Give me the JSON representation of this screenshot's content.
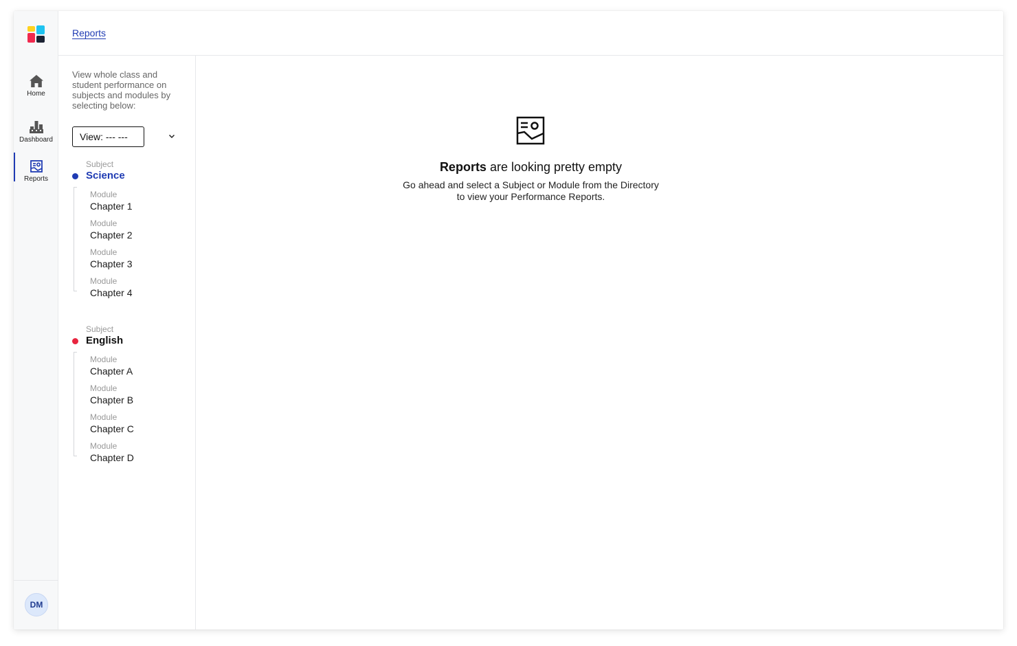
{
  "nav": {
    "logo_colors": [
      "#ffd21f",
      "#1fc3f0",
      "#f0294e",
      "#1b2233"
    ],
    "items": [
      {
        "label": "Home",
        "icon": "home-icon"
      },
      {
        "label": "Dashboard",
        "icon": "dashboard-icon"
      },
      {
        "label": "Reports",
        "icon": "reports-icon",
        "active": true
      }
    ],
    "user_initials": "DM"
  },
  "header": {
    "breadcrumb": "Reports"
  },
  "directory": {
    "intro": "View whole class and student performance on subjects and modules by selecting below:",
    "view_select": "View: --- ---",
    "subjects": [
      {
        "kicker": "Subject",
        "name": "Science",
        "color": "#1f3bb3",
        "modules": [
          {
            "kicker": "Module",
            "name": "Chapter 1"
          },
          {
            "kicker": "Module",
            "name": "Chapter 2"
          },
          {
            "kicker": "Module",
            "name": "Chapter 3"
          },
          {
            "kicker": "Module",
            "name": "Chapter 4"
          }
        ]
      },
      {
        "kicker": "Subject",
        "name": "English",
        "color": "#e8253f",
        "modules": [
          {
            "kicker": "Module",
            "name": "Chapter A"
          },
          {
            "kicker": "Module",
            "name": "Chapter B"
          },
          {
            "kicker": "Module",
            "name": "Chapter C"
          },
          {
            "kicker": "Module",
            "name": "Chapter D"
          }
        ]
      }
    ]
  },
  "empty_state": {
    "icon": "report-image-icon",
    "title_bold": "Reports",
    "title_rest": " are looking pretty empty",
    "body_line1": "Go ahead and select a Subject or Module from the Directory",
    "body_line2": "to view your Performance Reports."
  }
}
